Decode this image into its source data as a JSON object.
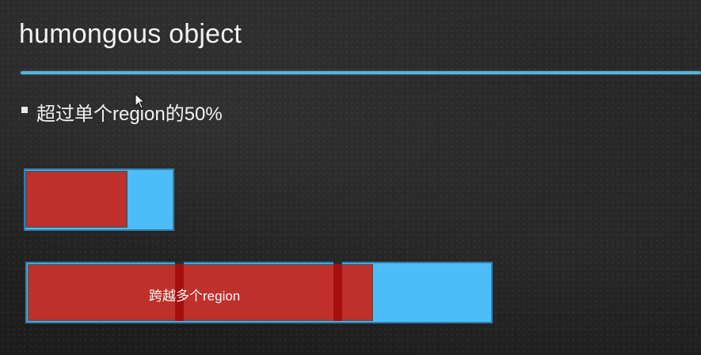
{
  "slide": {
    "title": "humongous object",
    "bullet": "超过单个region的50%",
    "spanning_label": "跨越多个region"
  },
  "colors": {
    "background": "#222222",
    "divider": "#5bbbe3",
    "region_blue": "#4dbdf9",
    "object_red": "#c0302a",
    "region_seam": "#a50f0f"
  },
  "icons": {
    "bullet": "square-bullet-icon",
    "pointer": "mouse-pointer-icon"
  }
}
